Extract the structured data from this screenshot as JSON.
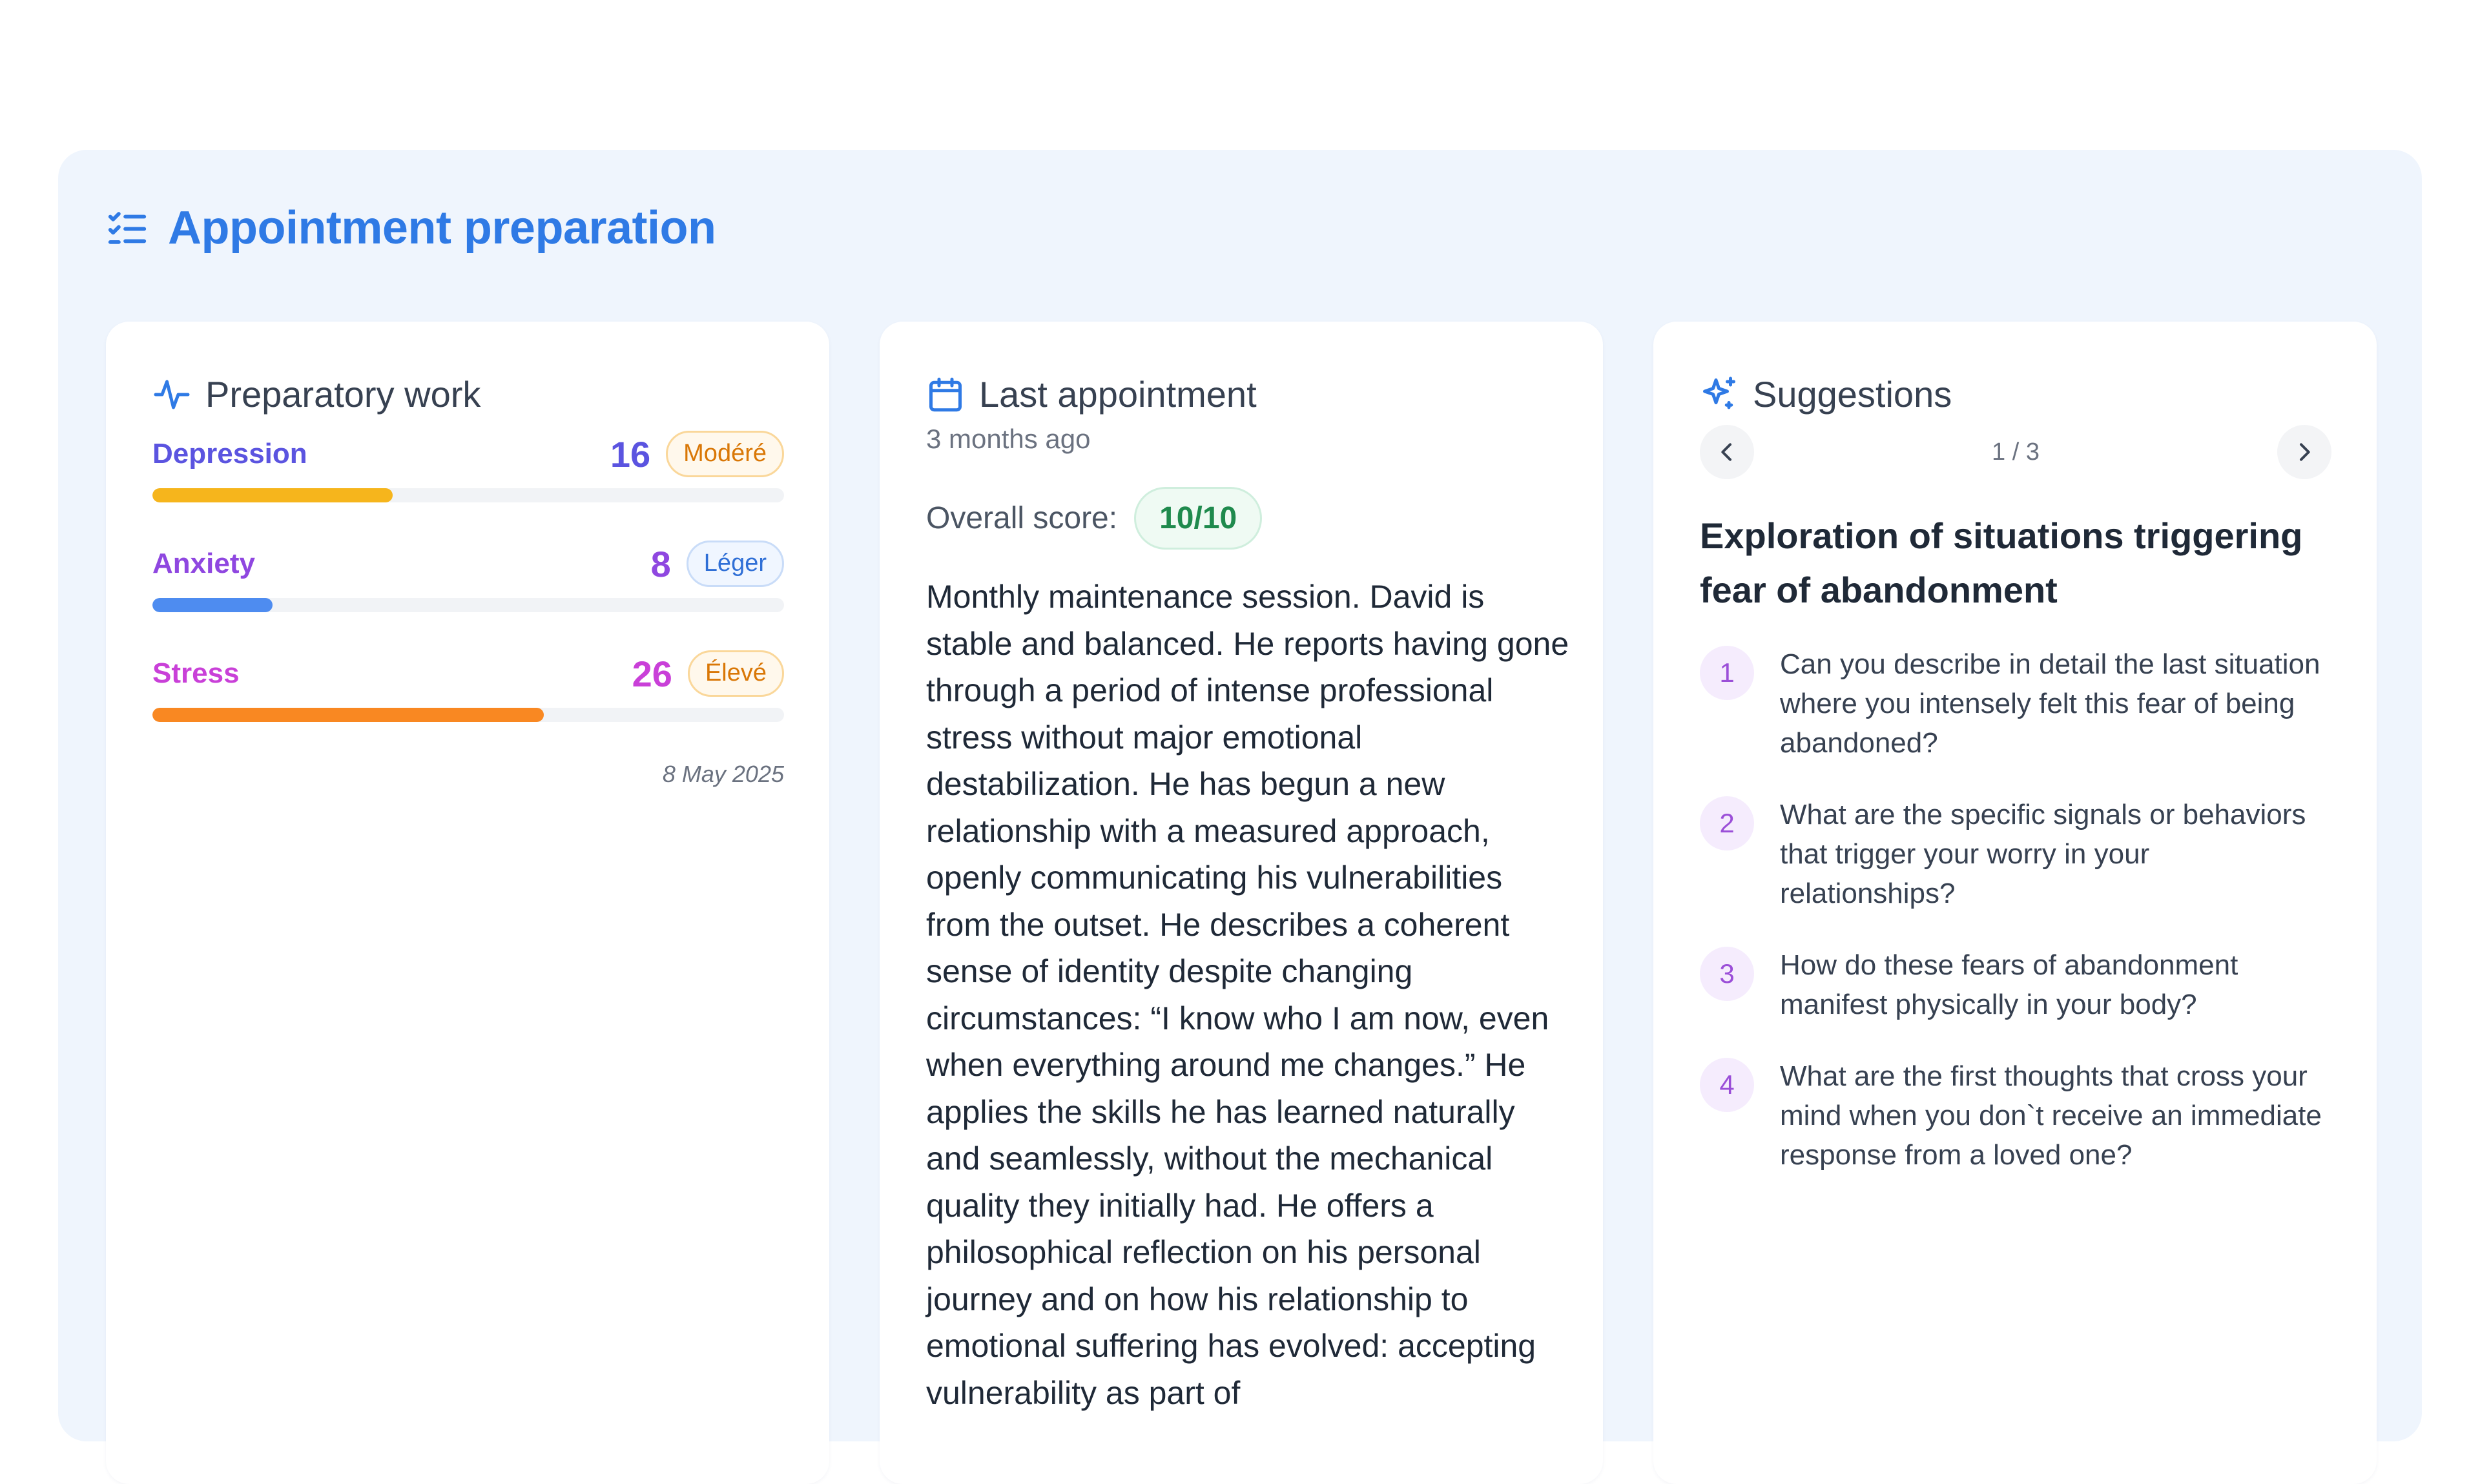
{
  "header": {
    "title": "Appointment preparation",
    "icon": "checklist-icon",
    "accent_color": "#2f7ae5"
  },
  "preparatory": {
    "title": "Preparatory work",
    "icon": "activity-icon",
    "date": "8 May 2025",
    "metrics": [
      {
        "name": "Depression",
        "score": "16",
        "level": "Modéré",
        "fraction": 0.38,
        "name_color": "#5b54e0",
        "score_color": "#5b54e0",
        "bar_color": "#f6b51c",
        "badge_color": "#d97706",
        "badge_border": "#fad79a",
        "badge_bg": "#fff8ec"
      },
      {
        "name": "Anxiety",
        "score": "8",
        "level": "Léger",
        "fraction": 0.19,
        "name_color": "#8f47e0",
        "score_color": "#8f47e0",
        "bar_color": "#4e8cf0",
        "badge_color": "#2f6fd6",
        "badge_border": "#c9dcf8",
        "badge_bg": "#f0f6ff"
      },
      {
        "name": "Stress",
        "score": "26",
        "level": "Élevé",
        "fraction": 0.62,
        "name_color": "#c940d8",
        "score_color": "#c940d8",
        "bar_color": "#f98822",
        "badge_color": "#d97706",
        "badge_border": "#fad79a",
        "badge_bg": "#fff8ec"
      }
    ]
  },
  "last_appointment": {
    "title": "Last appointment",
    "icon": "calendar-icon",
    "time_ago": "3 months ago",
    "score_label": "Overall score:",
    "score_value": "10/10",
    "summary": "Monthly maintenance session. David is stable and balanced. He reports having gone through a period of intense professional stress without major emotional destabilization. He has begun a new relationship with a measured approach, openly communicating his vulnerabilities from the outset. He describes a coherent sense of identity despite changing circumstances: “I know who I am now, even when everything around me changes.” He applies the skills he has learned naturally and seamlessly, without the mechanical quality they initially had. He offers a philosophical reflection on his personal journey and on how his relationship to emotional suffering has evolved: accepting vulnerability as part of"
  },
  "suggestions": {
    "title": "Suggestions",
    "icon": "sparkles-icon",
    "pager": "1 / 3",
    "prev_icon": "chevron-left-icon",
    "next_icon": "chevron-right-icon",
    "heading": "Exploration of situations triggering fear of abandonment",
    "questions": [
      {
        "num": "1",
        "text": "Can you describe in detail the last situation where you intensely felt this fear of being abandoned?"
      },
      {
        "num": "2",
        "text": "What are the specific signals or behaviors that trigger your worry in your relationships?"
      },
      {
        "num": "3",
        "text": "How do these fears of abandonment manifest physically in your body?"
      },
      {
        "num": "4",
        "text": "What are the first thoughts that cross your mind when you don`t receive an immediate response from a loved one?"
      }
    ]
  }
}
